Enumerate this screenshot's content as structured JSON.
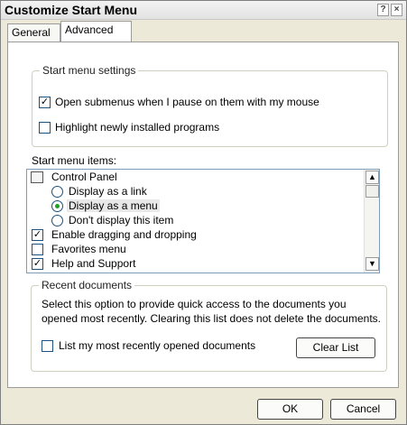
{
  "window": {
    "title": "Customize Start Menu"
  },
  "titlebar_buttons": {
    "help": "?",
    "close": "×"
  },
  "tabs": [
    {
      "label": "General"
    },
    {
      "label": "Advanced"
    }
  ],
  "start_menu_settings": {
    "legend": "Start menu settings",
    "open_submenus": {
      "label": "Open submenus when I pause on them with my mouse",
      "checked": true
    },
    "highlight_new": {
      "label": "Highlight newly installed programs",
      "checked": false
    }
  },
  "start_menu_items": {
    "label": "Start menu items:",
    "items": [
      {
        "type": "category",
        "text": "Control Panel",
        "icon": "control-panel-icon"
      },
      {
        "type": "radio",
        "text": "Display as a link",
        "checked": false
      },
      {
        "type": "radio",
        "text": "Display as a menu",
        "checked": true
      },
      {
        "type": "radio",
        "text": "Don't display this item",
        "checked": false
      },
      {
        "type": "checkbox",
        "text": "Enable dragging and dropping",
        "checked": true
      },
      {
        "type": "checkbox",
        "text": "Favorites menu",
        "checked": false
      },
      {
        "type": "checkbox",
        "text": "Help and Support",
        "checked": true
      }
    ]
  },
  "recent_documents": {
    "legend": "Recent documents",
    "description_line1": "Select this option to provide quick access to the documents you",
    "description_line2": "opened most recently.  Clearing this list does not delete the documents.",
    "list_recent": {
      "label": "List my most recently opened documents",
      "checked": false
    },
    "clear_list_button": "Clear List"
  },
  "footer": {
    "ok_button": "OK",
    "cancel_button": "Cancel"
  },
  "icons": {
    "check": "✓",
    "scroll_up": "▲",
    "scroll_down": "▼"
  }
}
